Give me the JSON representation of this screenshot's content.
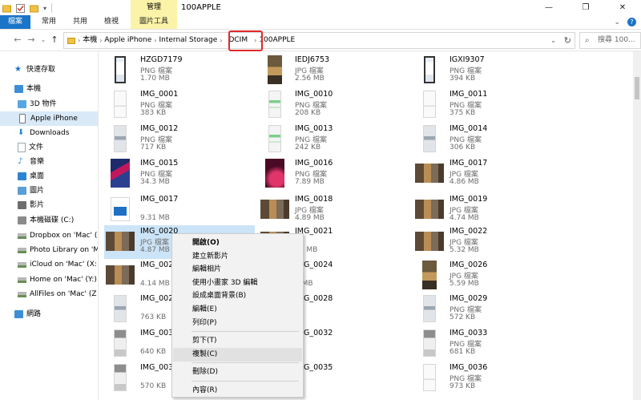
{
  "window": {
    "title": "100APPLE",
    "contextual_tab": "管理",
    "controls": [
      "—",
      "❐",
      "✕"
    ]
  },
  "ribbon": {
    "tabs": [
      "檔案",
      "常用",
      "共用",
      "檢視",
      "圖片工具"
    ]
  },
  "address": {
    "crumbs": [
      "本機",
      "Apple iPhone",
      "Internal Storage",
      "DCIM",
      "100APPLE"
    ],
    "highlighted_crumb": "DCIM",
    "search_placeholder": "搜尋 100..."
  },
  "nav": {
    "items": [
      {
        "label": "快速存取",
        "icon": "star-icon"
      },
      {
        "label": "本機",
        "icon": "computer-icon"
      },
      {
        "label": "3D 物件",
        "icon": "3d-objects-icon"
      },
      {
        "label": "Apple iPhone",
        "icon": "phone-icon",
        "selected": true
      },
      {
        "label": "Downloads",
        "icon": "download-icon"
      },
      {
        "label": "文件",
        "icon": "document-icon"
      },
      {
        "label": "音樂",
        "icon": "music-icon"
      },
      {
        "label": "桌面",
        "icon": "desktop-icon"
      },
      {
        "label": "圖片",
        "icon": "pictures-icon"
      },
      {
        "label": "影片",
        "icon": "videos-icon"
      },
      {
        "label": "本機磁碟 (C:)",
        "icon": "drive-icon"
      },
      {
        "label": "Dropbox on 'Mac' (",
        "icon": "network-drive-icon"
      },
      {
        "label": "Photo Library on 'M",
        "icon": "network-drive-icon"
      },
      {
        "label": "iCloud on 'Mac' (X:",
        "icon": "network-drive-icon"
      },
      {
        "label": "Home on 'Mac' (Y:)",
        "icon": "network-drive-icon"
      },
      {
        "label": "AllFiles on 'Mac' (Z",
        "icon": "network-drive-icon"
      },
      {
        "label": "網路",
        "icon": "network-icon"
      }
    ]
  },
  "colors": {
    "accent": "#1a74c7",
    "contextual_tab": "#fbf3a8",
    "selection": "#cce4f7",
    "nav_selection": "#d9e9f7",
    "highlight_box": "#e0292b"
  },
  "files": [
    {
      "name": "HZGD7179",
      "type": "PNG 檔案",
      "size": "1.70 MB",
      "thumb": "phone"
    },
    {
      "name": "IEDJ6753",
      "type": "JPG 檔案",
      "size": "2.56 MB",
      "thumb": "photo-warm"
    },
    {
      "name": "IGXI9307",
      "type": "PNG 檔案",
      "size": "394 KB",
      "thumb": "phone"
    },
    {
      "name": "IMG_0001",
      "type": "PNG 檔案",
      "size": "383 KB",
      "thumb": "screen-white"
    },
    {
      "name": "IMG_0010",
      "type": "PNG 檔案",
      "size": "208 KB",
      "thumb": "screen-green"
    },
    {
      "name": "IMG_0011",
      "type": "PNG 檔案",
      "size": "375 KB",
      "thumb": "screen-white"
    },
    {
      "name": "IMG_0012",
      "type": "PNG 檔案",
      "size": "717 KB",
      "thumb": "screen-grey"
    },
    {
      "name": "IMG_0013",
      "type": "PNG 檔案",
      "size": "242 KB",
      "thumb": "screen-green"
    },
    {
      "name": "IMG_0014",
      "type": "PNG 檔案",
      "size": "306 KB",
      "thumb": "screen-grey"
    },
    {
      "name": "IMG_0015",
      "type": "PNG 檔案",
      "size": "34.3 MB",
      "thumb": "wallpaper-blue"
    },
    {
      "name": "IMG_0016",
      "type": "PNG 檔案",
      "size": "7.89 MB",
      "thumb": "wallpaper-red"
    },
    {
      "name": "IMG_0017",
      "type": "JPG 檔案",
      "size": "4.86 MB",
      "thumb": "photo-wide"
    },
    {
      "name": "IMG_0017",
      "type": "",
      "size": "9.31 MB",
      "thumb": "video"
    },
    {
      "name": "IMG_0018",
      "type": "JPG 檔案",
      "size": "4.89 MB",
      "thumb": "photo-wide"
    },
    {
      "name": "IMG_0019",
      "type": "JPG 檔案",
      "size": "4.74 MB",
      "thumb": "photo-wide"
    },
    {
      "name": "IMG_0020",
      "type": "JPG 檔案",
      "size": "4.87 MB",
      "thumb": "photo-wide",
      "selected": true
    },
    {
      "name": "IMG_0021",
      "type": "",
      "size": "21 MB",
      "thumb": "photo-wide"
    },
    {
      "name": "IMG_0022",
      "type": "JPG 檔案",
      "size": "5.32 MB",
      "thumb": "photo-wide"
    },
    {
      "name": "IMG_002",
      "type": "",
      "size": "4.14 MB",
      "thumb": "photo-wide"
    },
    {
      "name": "IMG_0024",
      "type": "",
      "size": "0 MB",
      "thumb": "photo-warm"
    },
    {
      "name": "IMG_0026",
      "type": "JPG 檔案",
      "size": "5.59 MB",
      "thumb": "photo-warm"
    },
    {
      "name": "IMG_002",
      "type": "",
      "size": "763 KB",
      "thumb": "screen-grey"
    },
    {
      "name": "IMG_0028",
      "type": "",
      "size": "",
      "thumb": "screen-grey"
    },
    {
      "name": "IMG_0029",
      "type": "PNG 檔案",
      "size": "572 KB",
      "thumb": "screen-grey"
    },
    {
      "name": "IMG_003",
      "type": "",
      "size": "640 KB",
      "thumb": "screen-dark"
    },
    {
      "name": "IMG_0032",
      "type": "",
      "size": "",
      "thumb": "screen-dark"
    },
    {
      "name": "IMG_0033",
      "type": "PNG 檔案",
      "size": "681 KB",
      "thumb": "screen-dark"
    },
    {
      "name": "IMG_003",
      "type": "",
      "size": "570 KB",
      "thumb": "screen-dark"
    },
    {
      "name": "IMG_0035",
      "type": "",
      "size": "",
      "thumb": "screen-dark"
    },
    {
      "name": "IMG_0036",
      "type": "PNG 檔案",
      "size": "973 KB",
      "thumb": "screen-white"
    }
  ],
  "context_menu": {
    "items": [
      {
        "label": "開啟(O)",
        "bold": true
      },
      {
        "label": "建立新影片"
      },
      {
        "label": "編輯相片"
      },
      {
        "label": "使用小畫家 3D 編輯"
      },
      {
        "label": "設成桌面背景(B)"
      },
      {
        "label": "編輯(E)"
      },
      {
        "label": "列印(P)"
      },
      {
        "separator": true
      },
      {
        "label": "剪下(T)"
      },
      {
        "label": "複製(C)",
        "highlighted": true
      },
      {
        "separator": true
      },
      {
        "label": "刪除(D)"
      },
      {
        "separator": true
      },
      {
        "label": "內容(R)"
      }
    ]
  }
}
